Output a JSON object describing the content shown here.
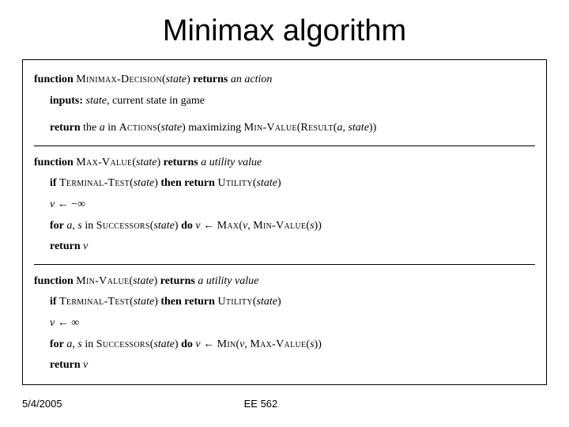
{
  "title": "Minimax algorithm",
  "footer": {
    "date": "5/4/2005",
    "course": "EE 562"
  },
  "algo": {
    "f1": {
      "kw_function": "function",
      "name": "Minimax-Decision",
      "arg": "state",
      "kw_returns": "returns",
      "ret": "an action",
      "kw_inputs": "inputs:",
      "inputs_var": "state",
      "inputs_desc": ", current state in game",
      "kw_return": "return",
      "txt1": " the ",
      "a": "a",
      "txt2": " in ",
      "actions": "Actions",
      "lp": "(",
      "state2": "state",
      "rp": ")",
      "txt3": " maximizing ",
      "minval": "Min-Value",
      "result": "Result",
      "comma": ", ",
      "state3": "state",
      "rp2": "))"
    },
    "f2": {
      "kw_function": "function",
      "name": "Max-Value",
      "arg": "state",
      "kw_returns": "returns",
      "ret": "a utility value",
      "kw_if": "if",
      "termtest": "Terminal-Test",
      "state2": "state",
      "kw_then": "then return",
      "utility": "Utility",
      "state3": "state",
      "assign_v": "v",
      "assign_arrow": " ← −∞",
      "kw_for": "for",
      "a": "a",
      "comma_s": ", ",
      "s": "s",
      "txt_in": " in ",
      "succ": "Successors",
      "state4": "state",
      "kw_do": "do",
      "v2": "v",
      "arrow2": " ← ",
      "max": "Max",
      "v3": "v",
      "minval": "Min-Value",
      "s2": "s",
      "kw_return": "return",
      "v4": "v"
    },
    "f3": {
      "kw_function": "function",
      "name": "Min-Value",
      "arg": "state",
      "kw_returns": "returns",
      "ret": "a utility value",
      "kw_if": "if",
      "termtest": "Terminal-Test",
      "state2": "state",
      "kw_then": "then return",
      "utility": "Utility",
      "state3": "state",
      "assign_v": "v",
      "assign_arrow": " ← ∞",
      "kw_for": "for",
      "a": "a",
      "comma_s": ", ",
      "s": "s",
      "txt_in": " in ",
      "succ": "Successors",
      "state4": "state",
      "kw_do": "do",
      "v2": "v",
      "arrow2": " ← ",
      "min": "Min",
      "v3": "v",
      "maxval": "Max-Value",
      "s2": "s",
      "kw_return": "return",
      "v4": "v"
    }
  }
}
